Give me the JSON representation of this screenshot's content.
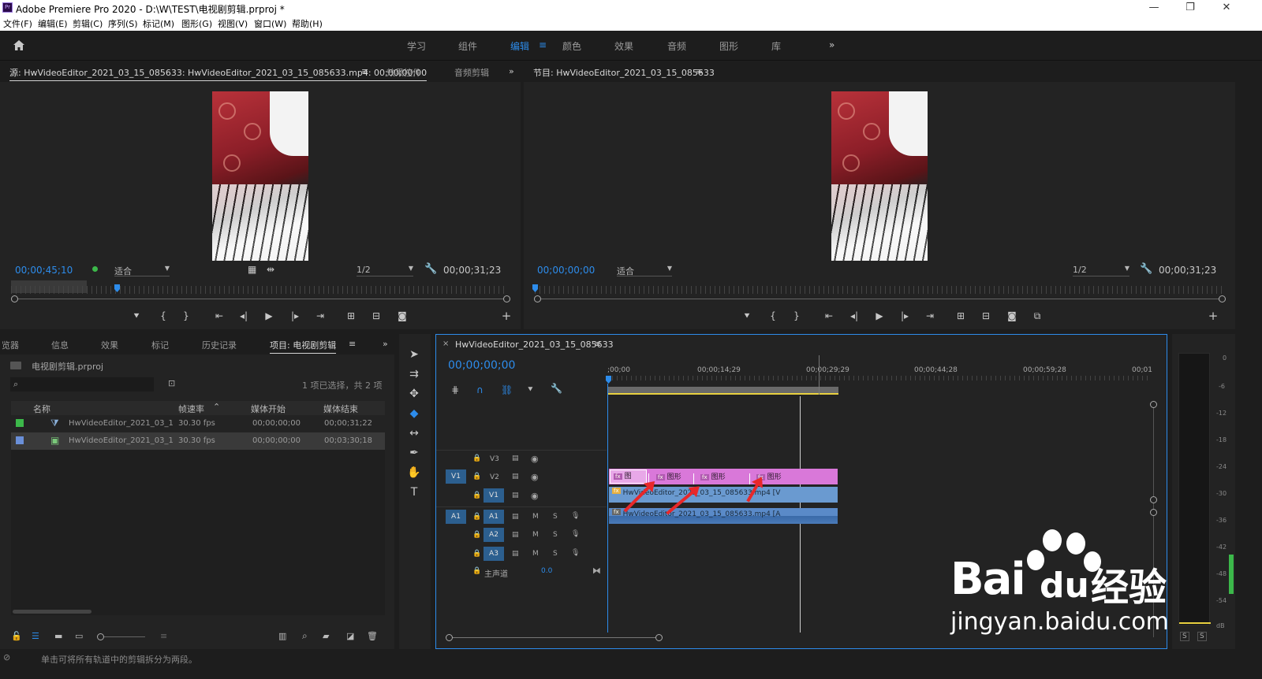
{
  "window": {
    "title": "Adobe Premiere Pro 2020 - D:\\W\\TEST\\电视剧剪辑.prproj *",
    "app_icon": "Pr",
    "minimize": "—",
    "restore": "❐",
    "close": "✕"
  },
  "menu": [
    "文件(F)",
    "编辑(E)",
    "剪辑(C)",
    "序列(S)",
    "标记(M)",
    "图形(G)",
    "视图(V)",
    "窗口(W)",
    "帮助(H)"
  ],
  "workspaces": {
    "items": [
      "学习",
      "组件",
      "编辑",
      "颜色",
      "效果",
      "音频",
      "图形",
      "库"
    ],
    "active": "编辑",
    "more": "»"
  },
  "source_monitor": {
    "tabs": [
      "源: HwVideoEditor_2021_03_15_085633: HwVideoEditor_2021_03_15_085633.mp4: 00;00;00;00",
      "效果控件",
      "音频剪辑"
    ],
    "more": "»",
    "timecode_current": "00;00;45;10",
    "fit": "适合",
    "resolution": "1/2",
    "timecode_duration": "00;00;31;23"
  },
  "program_monitor": {
    "tab": "节目: HwVideoEditor_2021_03_15_085633",
    "timecode_current": "00;00;00;00",
    "fit": "适合",
    "resolution": "1/2",
    "timecode_duration": "00;00;31;23"
  },
  "project_panel": {
    "tabs": [
      "览器",
      "信息",
      "效果",
      "标记",
      "历史记录",
      "项目: 电视剧剪辑"
    ],
    "more": "»",
    "project_file": "电视剧剪辑.prproj",
    "selection_info": "1 项已选择，共 2 项",
    "columns": [
      "名称",
      "帧速率",
      "媒体开始",
      "媒体结束"
    ],
    "rows": [
      {
        "name": "HwVideoEditor_2021_03_1",
        "fps": "30.30 fps",
        "start": "00;00;00;00",
        "end": "00;00;31;22",
        "color": "#3cb84a"
      },
      {
        "name": "HwVideoEditor_2021_03_1",
        "fps": "30.30 fps",
        "start": "00;00;00;00",
        "end": "00;03;30;18",
        "color": "#6a8fd8"
      }
    ]
  },
  "timeline": {
    "sequence_tab": "HwVideoEditor_2021_03_15_085633",
    "timecode": "00;00;00;00",
    "ruler": [
      ";00;00",
      "00;00;14;29",
      "00;00;29;29",
      "00;00;44;28",
      "00;00;59;28",
      "00;01"
    ],
    "tracks": {
      "video": [
        "V3",
        "V2",
        "V1"
      ],
      "audio": [
        "A1",
        "A2",
        "A3"
      ],
      "source_v": "V1",
      "source_a": "A1",
      "master": "主声道",
      "master_value": "0.0",
      "mute": "M",
      "solo": "S"
    },
    "clips": {
      "graphics": [
        "图",
        "图形",
        "图形",
        "图形"
      ],
      "fx": "fx",
      "video": "HwVideoEditor_2021_03_15_085633.mp4 [V",
      "audio": "HwVideoEditor_2021_03_15_085633.mp4 [A"
    }
  },
  "meters": {
    "labels": [
      "0",
      "-6",
      "-12",
      "-18",
      "-24",
      "-30",
      "-36",
      "-42",
      "-48",
      "-54",
      "dB"
    ],
    "solo": [
      "S",
      "S"
    ]
  },
  "status": "单击可将所有轨道中的剪辑拆分为两段。",
  "watermark": {
    "main": "Bai",
    "du": "du",
    "cn": "经验",
    "url": "jingyan.baidu.com"
  },
  "colors": {
    "accent": "#2d8ceb",
    "graphics_clip": "#d978d9",
    "video_clip": "#6a9ad0",
    "arrow": "#e8282a"
  }
}
